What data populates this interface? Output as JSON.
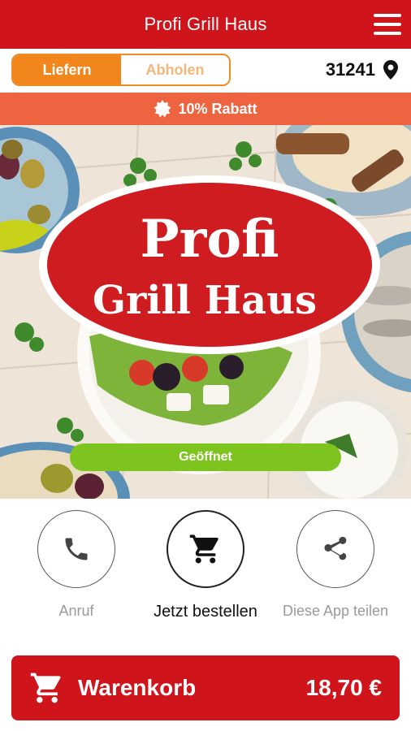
{
  "app": {
    "title": "Profi Grill Haus"
  },
  "mode": {
    "deliver_label": "Liefern",
    "pickup_label": "Abholen",
    "selected": "Liefern"
  },
  "location": {
    "zip": "31241"
  },
  "promo": {
    "label": "10% Rabatt"
  },
  "hero": {
    "logo_line1": "Profi",
    "logo_line2": "Grill Haus",
    "status": "Geöffnet"
  },
  "actions": {
    "call_label": "Anruf",
    "order_label": "Jetzt bestellen",
    "share_label": "Diese App teilen"
  },
  "cart": {
    "label": "Warenkorb",
    "total": "18,70 €"
  },
  "colors": {
    "primary": "#d0141c",
    "accent": "#f0861c",
    "promo": "#ee6340",
    "open": "#7dc41f"
  },
  "icons": {
    "menu": "hamburger-icon",
    "location": "location-pin-icon",
    "promo": "badge-icon",
    "call": "phone-icon",
    "order": "cart-icon",
    "share": "share-icon",
    "cart": "cart-icon"
  }
}
